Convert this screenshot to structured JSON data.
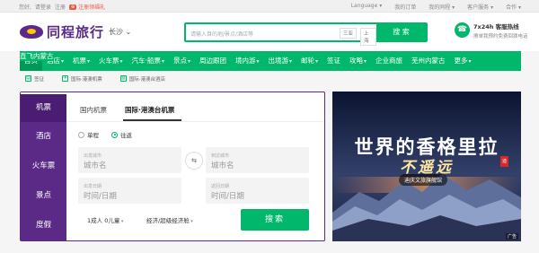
{
  "topbar": {
    "greeting": "您好,",
    "login": "请登录",
    "register": "注册",
    "gift_tag": "⊕",
    "gift": "注册领福礼",
    "right": [
      "Language ▾",
      "我的订单",
      "我的同程 ▾",
      "客户服务 ▾",
      "合作 ▾"
    ]
  },
  "header": {
    "logo_text": "同程旅行",
    "city": "长沙",
    "search_placeholder": "请输入目的地/景点/酒店等",
    "search_tag_1": "三亚",
    "search_tag_2": "上海",
    "search_button": "搜 索",
    "hotline_title": "7x24h 客服热线",
    "hotline_sub": "擦单我预约免费回拨电话"
  },
  "nav": {
    "items": [
      {
        "label": "首页",
        "active": true,
        "dd": false
      },
      {
        "label": "酒店",
        "active": false,
        "dd": true
      },
      {
        "label": "机票",
        "active": false,
        "dd": true
      },
      {
        "label": "火车票",
        "active": false,
        "dd": true
      },
      {
        "label": "汽车·船票",
        "active": false,
        "dd": true
      },
      {
        "label": "景点",
        "active": false,
        "dd": true
      },
      {
        "label": "周边跟团",
        "active": false,
        "dd": false
      },
      {
        "label": "境内游",
        "active": false,
        "dd": true
      },
      {
        "label": "出境游",
        "active": false,
        "dd": true
      },
      {
        "label": "邮轮",
        "active": false,
        "dd": true
      },
      {
        "label": "签证",
        "active": false,
        "dd": false
      },
      {
        "label": "攻略",
        "active": false,
        "dd": true
      },
      {
        "label": "企业商旅",
        "active": false,
        "dd": false
      },
      {
        "label": "芜州内蒙古",
        "active": false,
        "dd": false
      },
      {
        "label": "更多",
        "active": false,
        "dd": true
      }
    ],
    "hot_badge": "直飞内蒙古"
  },
  "crumbs": [
    {
      "icon": "visa-icon",
      "label": "签证"
    },
    {
      "icon": "plane-icon",
      "label": "国际·港澳机票"
    },
    {
      "icon": "hotel-icon",
      "label": "国际·港澳台酒店"
    }
  ],
  "booking": {
    "side_tabs": [
      "机票",
      "酒店",
      "火车票",
      "景点",
      "度假"
    ],
    "active_side": 0,
    "tabs": [
      "国内机票",
      "国际·港澳台机票"
    ],
    "active_tab": 1,
    "trip_types": [
      "单程",
      "往返"
    ],
    "trip_selected": 1,
    "from_label": "出发城市",
    "from_value": "城市名",
    "to_label": "到达城市",
    "to_value": "城市名",
    "swap_icon": "⇆",
    "depart_label": "出发日期",
    "depart_value": "时间/日期",
    "return_label": "返回日期",
    "return_value": "时间/日期",
    "passengers": "1成人 0儿童",
    "cabin": "经济/超级经济舱",
    "search_button": "搜索"
  },
  "banner": {
    "title_line1": "世界的香格里拉",
    "title_line2": "不遥远",
    "stamp": "迪",
    "pill": "迪庆文旅旗舰馆",
    "ad_mark": "广告"
  }
}
